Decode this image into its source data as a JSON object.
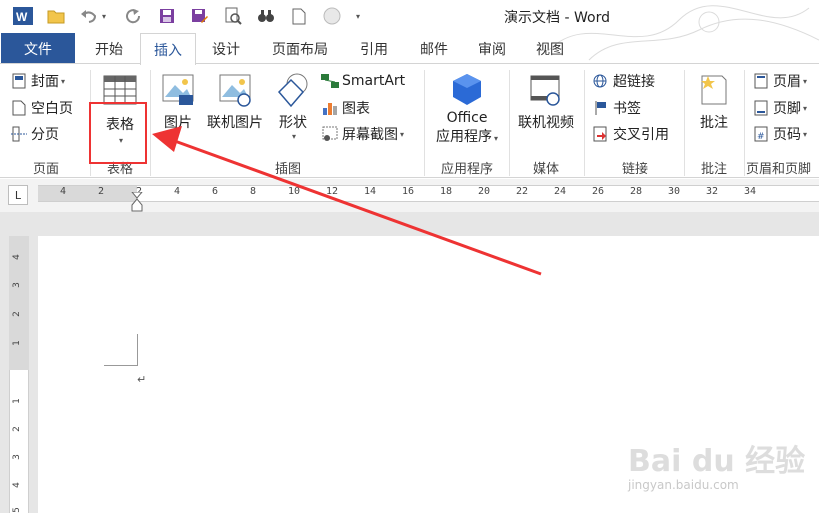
{
  "window": {
    "title": "演示文档 - Word"
  },
  "qat": {
    "icons": [
      "word-logo-icon",
      "open-folder-icon",
      "undo-icon",
      "redo-icon",
      "save-icon",
      "save-as-icon",
      "print-preview-icon",
      "find-icon",
      "new-doc-icon",
      "circle-icon",
      "customize-qat-icon"
    ]
  },
  "tabs": {
    "file": "文件",
    "home": "开始",
    "insert": "插入",
    "design": "设计",
    "layout": "页面布局",
    "references": "引用",
    "mailings": "邮件",
    "review": "审阅",
    "view": "视图"
  },
  "ribbon": {
    "pages": {
      "cover": "封面",
      "blank": "空白页",
      "break": "分页",
      "label": "页面"
    },
    "tables": {
      "table": "表格",
      "label": "表格"
    },
    "illustrations": {
      "picture": "图片",
      "online_picture": "联机图片",
      "shapes": "形状",
      "smartart": "SmartArt",
      "chart": "图表",
      "screenshot": "屏幕截图",
      "label": "插图"
    },
    "apps": {
      "office_line1": "Office",
      "office_line2": "应用程序",
      "label": "应用程序"
    },
    "media": {
      "online_video": "联机视频",
      "label": "媒体"
    },
    "links": {
      "hyperlink": "超链接",
      "bookmark": "书签",
      "cross_ref": "交叉引用",
      "label": "链接"
    },
    "comments": {
      "comment": "批注",
      "label": "批注"
    },
    "header_footer": {
      "header": "页眉",
      "footer": "页脚",
      "page_number": "页码",
      "label": "页眉和页脚"
    }
  },
  "ruler": {
    "tab_selector": "L",
    "numbers": [
      "4",
      "2",
      "2",
      "4",
      "6",
      "8",
      "10",
      "12",
      "14",
      "16",
      "18",
      "20",
      "22",
      "24",
      "26",
      "28",
      "30",
      "32",
      "34"
    ]
  },
  "vruler": {
    "numbers": [
      "4",
      "3",
      "2",
      "1",
      "1",
      "2",
      "3",
      "4",
      "5"
    ]
  },
  "document": {
    "paragraph_mark": "↵"
  },
  "colors": {
    "file_tab": "#2b579a",
    "highlight": "#ee3333",
    "accent": "#2b579a"
  },
  "watermark": {
    "text": "Bai du 经验",
    "url": "jingyan.baidu.com"
  }
}
